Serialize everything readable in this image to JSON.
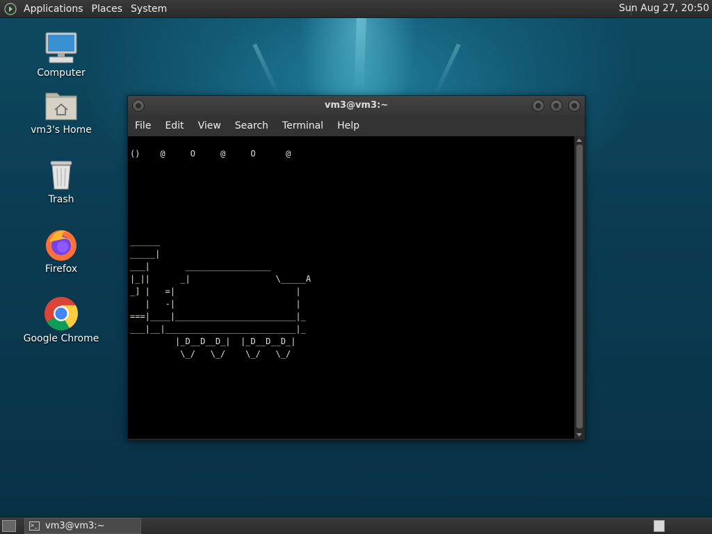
{
  "top_panel": {
    "menus": [
      "Applications",
      "Places",
      "System"
    ],
    "clock": "Sun Aug 27, 20:50"
  },
  "desktop_icons": [
    {
      "label": "Computer",
      "icon": "computer-icon"
    },
    {
      "label": "vm3's Home",
      "icon": "home-folder-icon"
    },
    {
      "label": "Trash",
      "icon": "trash-icon"
    },
    {
      "label": "Firefox",
      "icon": "firefox-icon"
    },
    {
      "label": "Google Chrome",
      "icon": "chrome-icon"
    }
  ],
  "terminal": {
    "title": "vm3@vm3:~",
    "menus": [
      "File",
      "Edit",
      "View",
      "Search",
      "Terminal",
      "Help"
    ],
    "content": "()    @     O     @     O      @\n\n\n\n\n\n\n______\n_____|\n___|       _________________\n|_||      _|                 \\_____A\n_] |   =|                        |\n   |   -|                        |\n===|____|________________________|_\n___|__|__________________________|_\n         |_D__D__D_|  |_D__D__D_|\n          \\_/   \\_/    \\_/   \\_/"
  },
  "bottom_panel": {
    "task_label": "vm3@vm3:~"
  },
  "colors": {
    "panel": "#2e2e2e",
    "desktop": "#0d4a61",
    "terminal_bg": "#000000"
  }
}
